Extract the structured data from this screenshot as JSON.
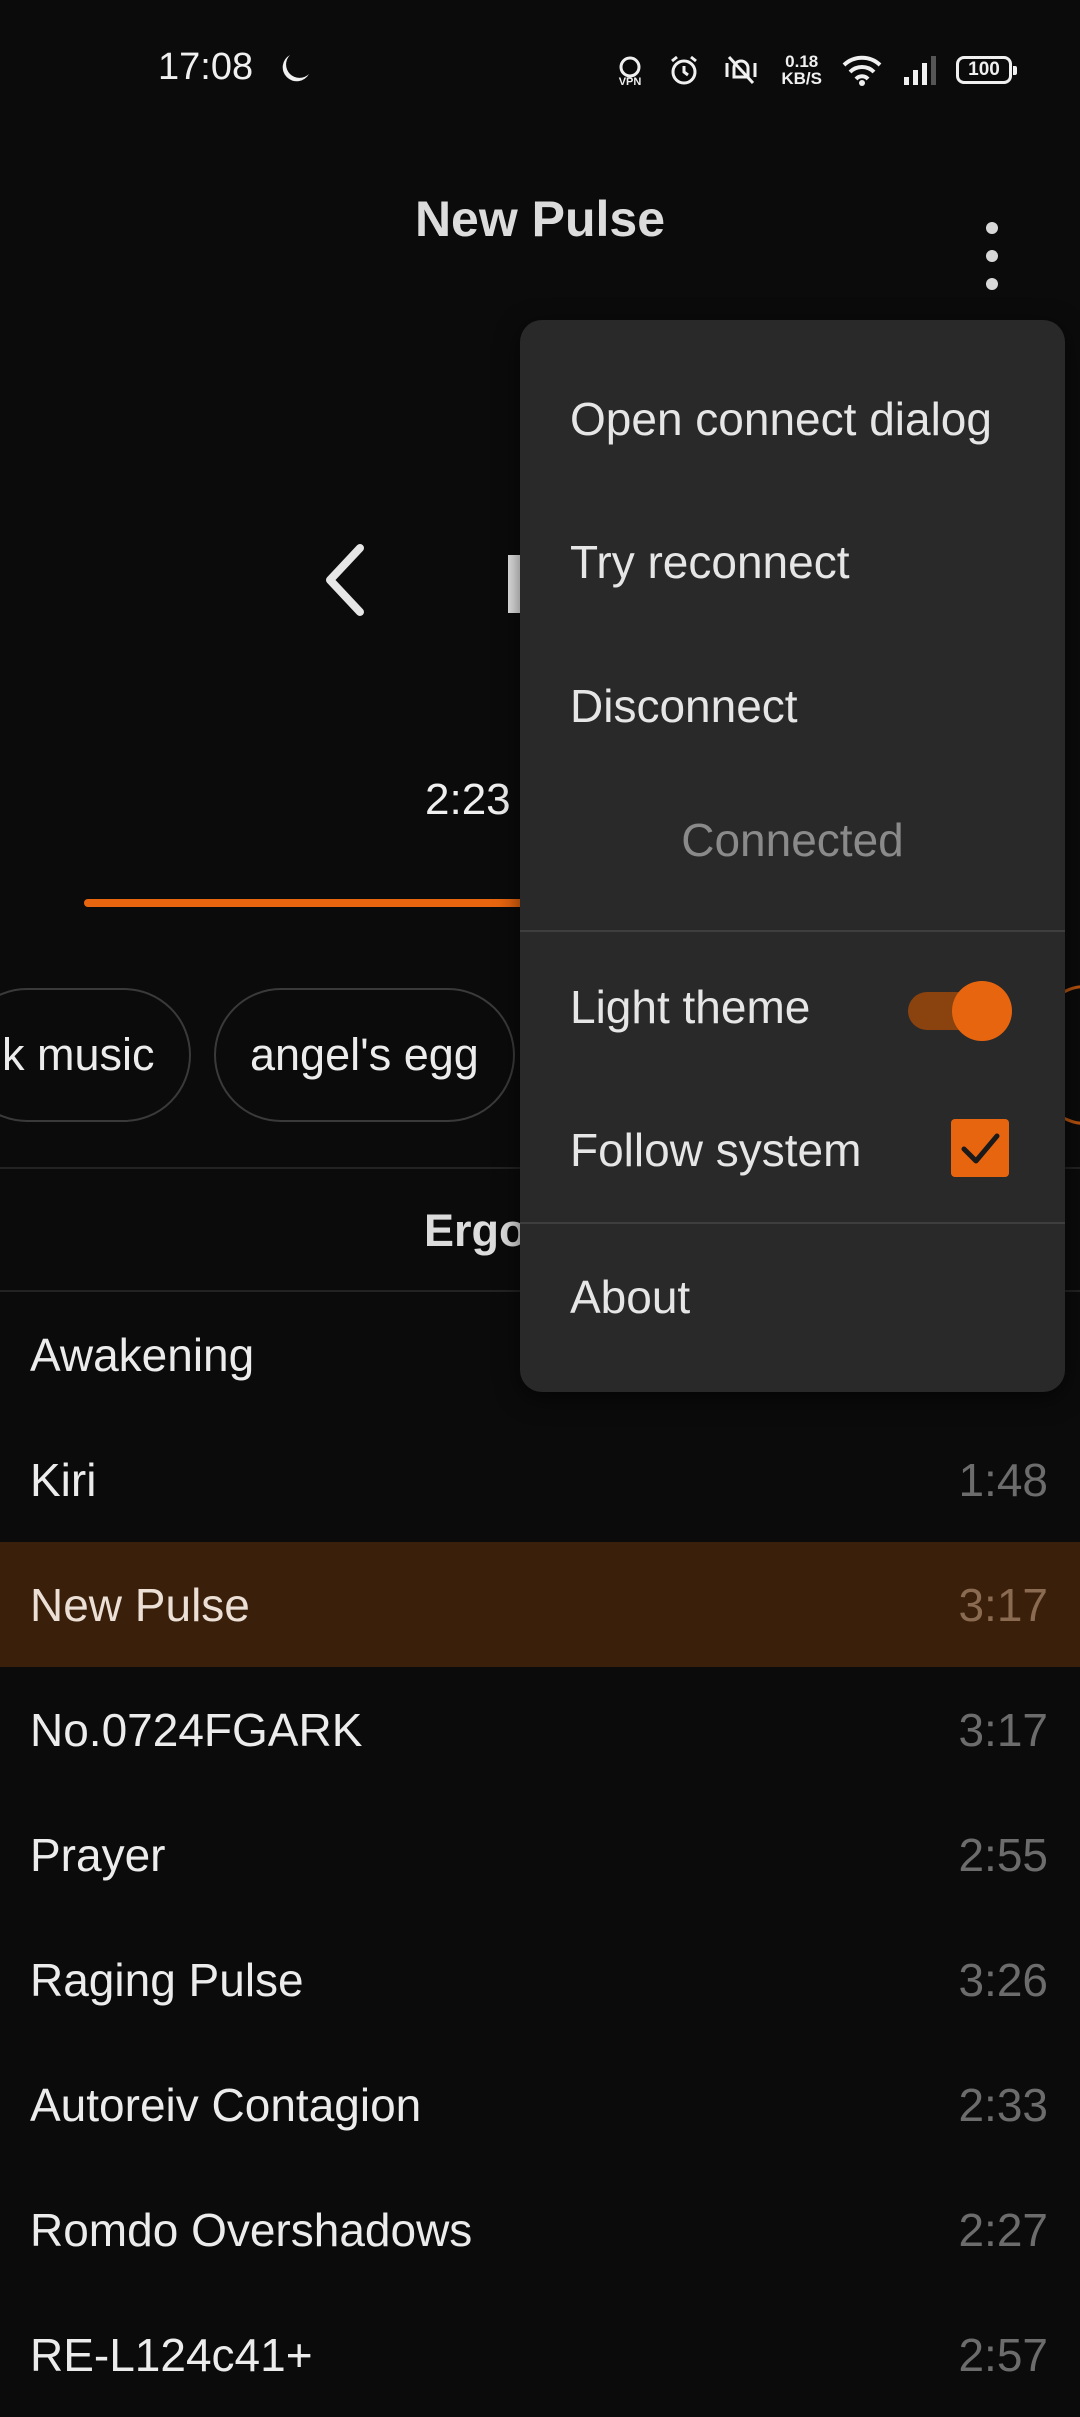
{
  "status_bar": {
    "time": "17:08",
    "net_speed_value": "0.18",
    "net_speed_unit": "KB/S",
    "battery": "100",
    "vpn_label": "VPN",
    "icons": [
      "moon-icon",
      "vpn-icon",
      "alarm-icon",
      "vibrate-icon",
      "wifi-icon",
      "signal-icon",
      "battery-icon"
    ]
  },
  "header": {
    "title": "New Pulse",
    "more_icon": "more-vert-icon"
  },
  "player": {
    "current_time": "2:23",
    "progress_fraction": 0.72,
    "prev_icon": "chevron-left-icon"
  },
  "tags": [
    "k music",
    "angel's egg"
  ],
  "album": {
    "title": "Ergo"
  },
  "tracks": [
    {
      "name": "Awakening",
      "duration": ""
    },
    {
      "name": "Kiri",
      "duration": "1:48"
    },
    {
      "name": "New Pulse",
      "duration": "3:17",
      "active": true
    },
    {
      "name": "No.0724FGARK",
      "duration": "3:17"
    },
    {
      "name": "Prayer",
      "duration": "2:55"
    },
    {
      "name": "Raging Pulse",
      "duration": "3:26"
    },
    {
      "name": "Autoreiv Contagion",
      "duration": "2:33"
    },
    {
      "name": "Romdo Overshadows",
      "duration": "2:27"
    },
    {
      "name": "RE-L124c41+",
      "duration": "2:57"
    }
  ],
  "menu": {
    "open_connect": "Open connect dialog",
    "try_reconnect": "Try reconnect",
    "disconnect": "Disconnect",
    "status": "Connected",
    "light_theme": "Light theme",
    "light_theme_on": true,
    "follow_system": "Follow system",
    "follow_system_checked": true,
    "about": "About"
  },
  "colors": {
    "accent": "#e8650f",
    "background": "#0b0b0b",
    "menu_background": "#292929",
    "active_row": "#3a1f0b"
  }
}
